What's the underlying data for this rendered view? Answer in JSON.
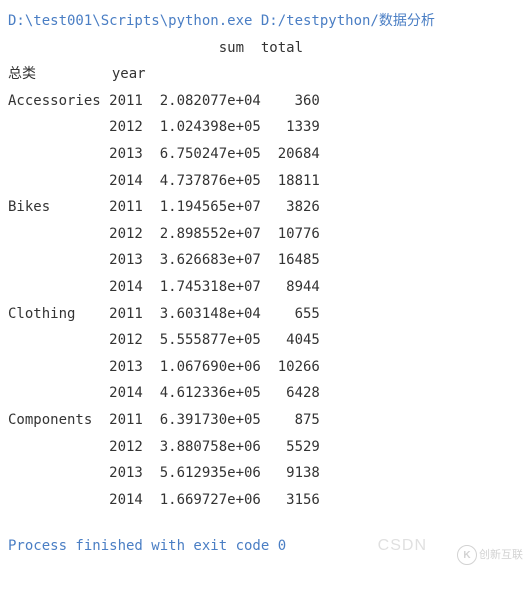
{
  "cmd": "D:\\test001\\Scripts\\python.exe D:/testpython/数据分析",
  "col_header": "                         sum  total",
  "idx_header": "总类         year              ",
  "rows": [
    "Accessories 2011  2.082077e+04    360",
    "            2012  1.024398e+05   1339",
    "            2013  6.750247e+05  20684",
    "            2014  4.737876e+05  18811",
    "Bikes       2011  1.194565e+07   3826",
    "            2012  2.898552e+07  10776",
    "            2013  3.626683e+07  16485",
    "            2014  1.745318e+07   8944",
    "Clothing    2011  3.603148e+04    655",
    "            2012  5.555877e+05   4045",
    "            2013  1.067690e+06  10266",
    "            2014  4.612336e+05   6428",
    "Components  2011  6.391730e+05    875",
    "            2012  3.880758e+06   5529",
    "            2013  5.612935e+06   9138",
    "            2014  1.669727e+06   3156"
  ],
  "exit": "Process finished with exit code 0",
  "watermark_csdn": "CSDN",
  "watermark_brand": "创新互联"
}
